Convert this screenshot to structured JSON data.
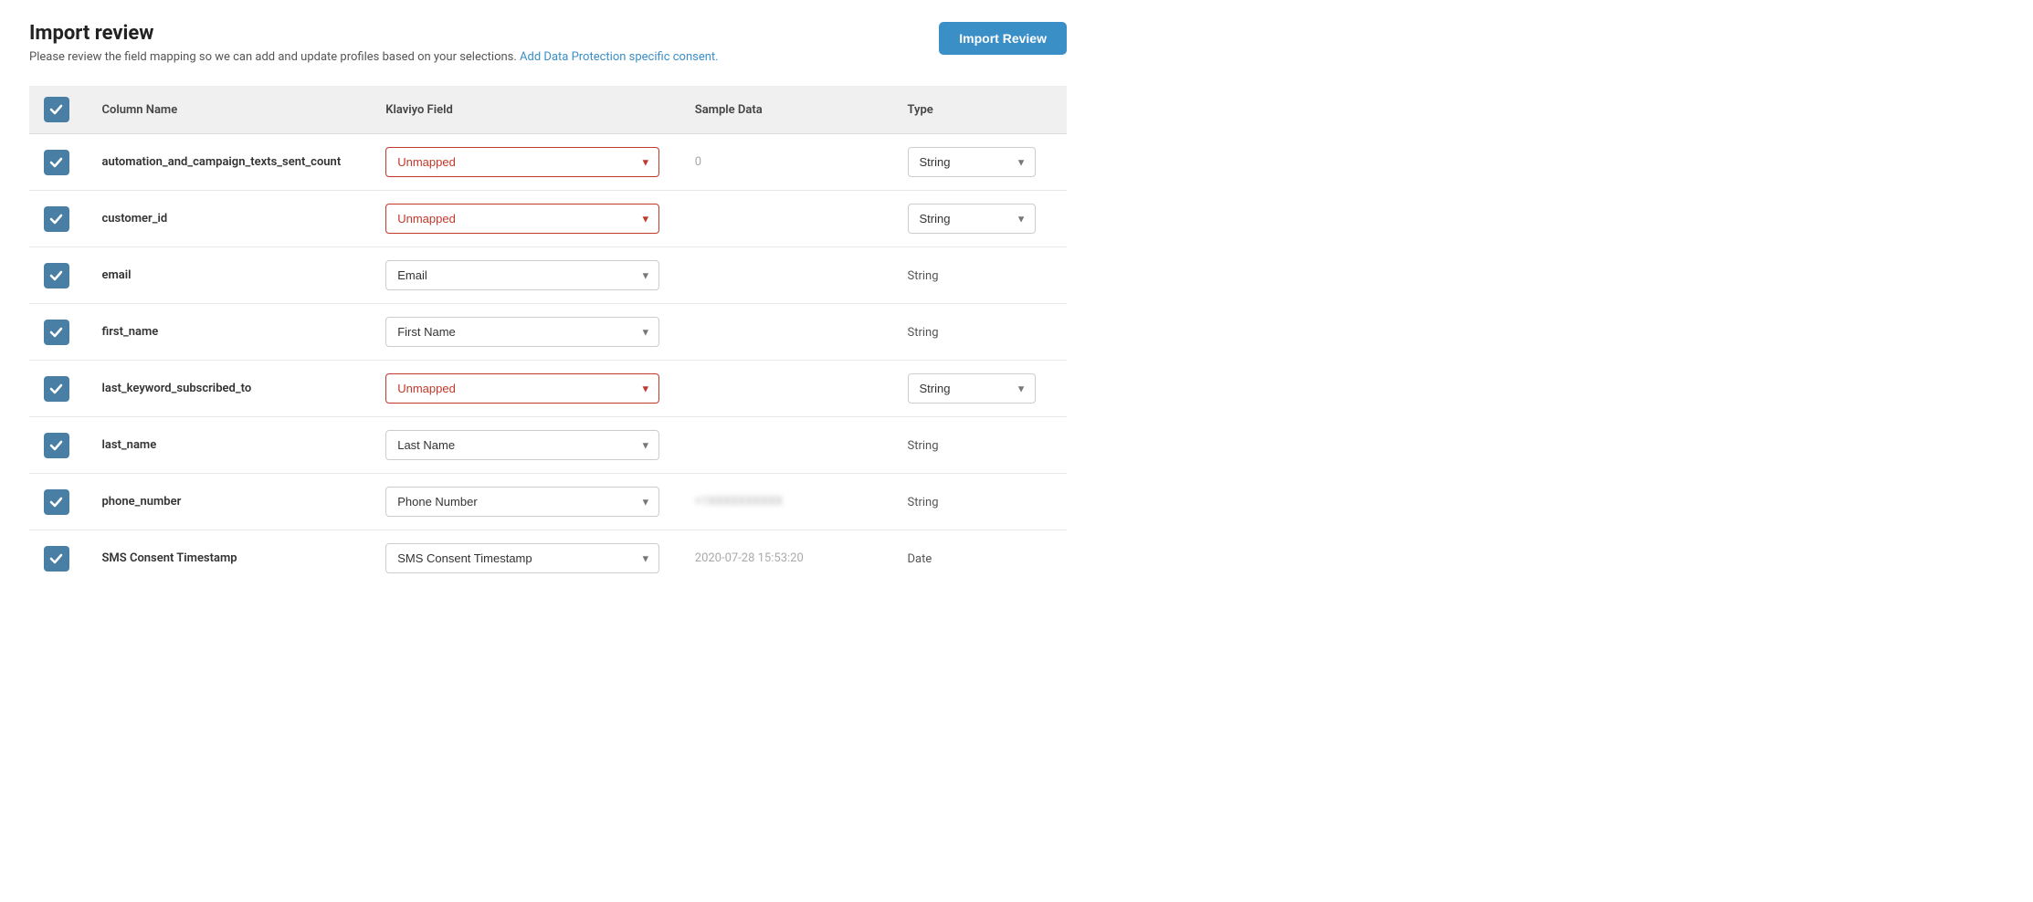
{
  "page": {
    "title": "Import review",
    "description": "Please review the field mapping so we can add and update profiles based on your selections.",
    "link_text": "Add Data Protection specific consent.",
    "import_review_button": "Import Review"
  },
  "table": {
    "headers": [
      "",
      "Column Name",
      "Klaviyo Field",
      "Sample Data",
      "Type"
    ],
    "rows": [
      {
        "checked": true,
        "column_name": "automation_and_campaign_texts_sent_count",
        "klaviyo_field": "Unmapped",
        "unmapped": true,
        "sample_data": "0",
        "type": "String",
        "type_has_dropdown": true
      },
      {
        "checked": true,
        "column_name": "customer_id",
        "klaviyo_field": "Unmapped",
        "unmapped": true,
        "sample_data": "",
        "type": "String",
        "type_has_dropdown": true
      },
      {
        "checked": true,
        "column_name": "email",
        "klaviyo_field": "Email",
        "unmapped": false,
        "sample_data": "",
        "type": "String",
        "type_has_dropdown": false
      },
      {
        "checked": true,
        "column_name": "first_name",
        "klaviyo_field": "First Name",
        "unmapped": false,
        "sample_data": "",
        "type": "String",
        "type_has_dropdown": false
      },
      {
        "checked": true,
        "column_name": "last_keyword_subscribed_to",
        "klaviyo_field": "Unmapped",
        "unmapped": true,
        "sample_data": "",
        "type": "String",
        "type_has_dropdown": true
      },
      {
        "checked": true,
        "column_name": "last_name",
        "klaviyo_field": "Last Name",
        "unmapped": false,
        "sample_data": "",
        "type": "String",
        "type_has_dropdown": false
      },
      {
        "checked": true,
        "column_name": "phone_number",
        "klaviyo_field": "Phone Number",
        "unmapped": false,
        "sample_data": "+1XXXXXXXXXX",
        "sample_blurred": true,
        "type": "String",
        "type_has_dropdown": false
      },
      {
        "checked": true,
        "column_name": "SMS Consent Timestamp",
        "klaviyo_field": "SMS Consent Timestamp",
        "unmapped": false,
        "sample_data": "2020-07-28 15:53:20",
        "type": "Date",
        "type_has_dropdown": false
      }
    ]
  }
}
